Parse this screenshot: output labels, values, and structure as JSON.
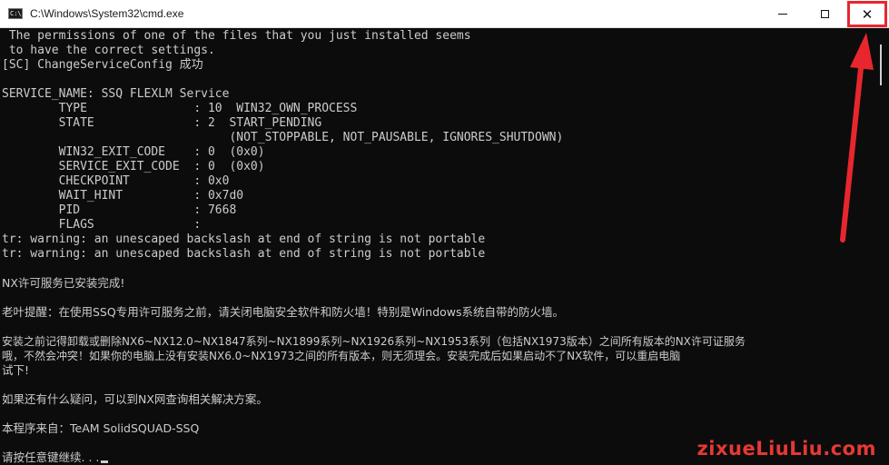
{
  "window": {
    "title": "C:\\Windows\\System32\\cmd.exe",
    "icon_text": "C:\\"
  },
  "controls": {
    "minimize": "minimize-icon",
    "maximize": "maximize-icon",
    "close": "close-icon",
    "close_glyph": "✕"
  },
  "console": {
    "lines": [
      " The permissions of one of the files that you just installed seems",
      " to have the correct settings.",
      "[SC] ChangeServiceConfig 成功",
      "",
      "SERVICE_NAME: SSQ FLEXLM Service",
      "        TYPE               : 10  WIN32_OWN_PROCESS",
      "        STATE              : 2  START_PENDING",
      "                                (NOT_STOPPABLE, NOT_PAUSABLE, IGNORES_SHUTDOWN)",
      "        WIN32_EXIT_CODE    : 0  (0x0)",
      "        SERVICE_EXIT_CODE  : 0  (0x0)",
      "        CHECKPOINT         : 0x0",
      "        WAIT_HINT          : 0x7d0",
      "        PID                : 7668",
      "        FLAGS              :",
      "tr: warning: an unescaped backslash at end of string is not portable",
      "tr: warning: an unescaped backslash at end of string is not portable",
      "",
      "NX许可服务已安装完成!",
      "",
      "老叶提醒：在使用SSQ专用许可服务之前，请关闭电脑安全软件和防火墙！特别是Windows系统自带的防火墙。",
      "",
      "安装之前记得卸载或删除NX6~NX12.0~NX1847系列~NX1899系列~NX1926系列~NX1953系列（包括NX1973版本）之间所有版本的NX许可证服务",
      "哦，不然会冲突！如果你的电脑上没有安装NX6.0~NX1973之间的所有版本，则无须理会。安装完成后如果启动不了NX软件，可以重启电脑",
      "试下!",
      "",
      "如果还有什么疑问，可以到NX网查询相关解决方案。",
      "",
      "本程序来自：TeAM SolidSQUAD-SSQ",
      "",
      "请按任意键继续. . ."
    ]
  },
  "watermark": {
    "text": "zixueLiuLiu.com"
  },
  "colors": {
    "background": "#0c0c0c",
    "text": "#cccccc",
    "annotation": "#e8262e"
  }
}
